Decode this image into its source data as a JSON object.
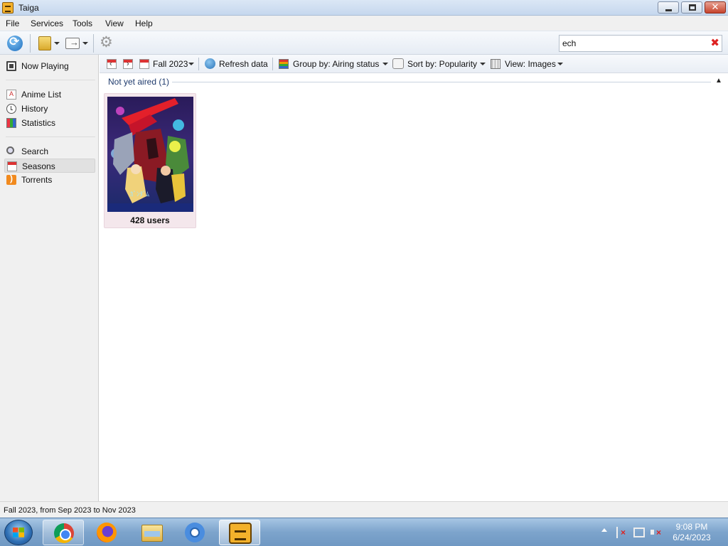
{
  "window": {
    "title": "Taiga"
  },
  "menu": [
    "File",
    "Services",
    "Tools",
    "View",
    "Help"
  ],
  "search": {
    "value": "ech"
  },
  "sidebar": {
    "items": [
      {
        "label": "Now Playing",
        "icon": "now-playing-icon"
      },
      {
        "label": "Anime List",
        "icon": "anime-list-icon"
      },
      {
        "label": "History",
        "icon": "history-icon"
      },
      {
        "label": "Statistics",
        "icon": "statistics-icon"
      },
      {
        "label": "Search",
        "icon": "search-icon"
      },
      {
        "label": "Seasons",
        "icon": "seasons-icon",
        "selected": true
      },
      {
        "label": "Torrents",
        "icon": "torrents-icon"
      }
    ]
  },
  "content_toolbar": {
    "season": "Fall 2023",
    "refresh": "Refresh data",
    "group_by": "Group by: Airing status",
    "sort_by": "Sort by: Popularity",
    "view": "View: Images"
  },
  "groups": [
    {
      "header": "Not yet aired (1)",
      "items": [
        {
          "label": "428 users"
        }
      ]
    }
  ],
  "status_bar": {
    "text": "Fall 2023, from Sep 2023 to Nov 2023"
  },
  "taskbar": {
    "apps": [
      "chrome-icon",
      "firefox-icon",
      "file-explorer-icon",
      "chromium-icon",
      "taiga-icon"
    ],
    "clock_time": "9:08 PM",
    "clock_date": "6/24/2023"
  },
  "colors": {
    "group_header": "#1f3b6d",
    "card_bg": "#f4e7ec",
    "accent": "#2a74b8"
  }
}
